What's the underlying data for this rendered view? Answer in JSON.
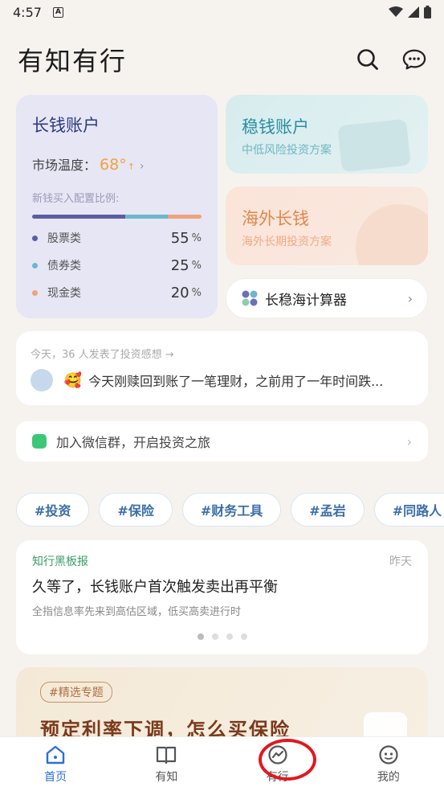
{
  "status_bar": {
    "time": "4:57",
    "notif": "A"
  },
  "header": {
    "title": "有知有行"
  },
  "long_account": {
    "name": "长钱账户",
    "temp_label": "市场温度：",
    "temp_value": "68°",
    "temp_arrow": "↑",
    "ratio_label": "新钱买入配置比例:",
    "colors": {
      "stocks": "#5a5ca6",
      "bonds": "#6cb8cb",
      "cash": "#eea37c"
    },
    "allocation": [
      {
        "label": "股票类",
        "pct": "55",
        "unit": "%",
        "fraction": 0.55
      },
      {
        "label": "债券类",
        "pct": "25",
        "unit": "%",
        "fraction": 0.25
      },
      {
        "label": "现金类",
        "pct": "20",
        "unit": "%",
        "fraction": 0.2
      }
    ]
  },
  "stable_account": {
    "name": "稳钱账户",
    "sub": "中低风险投资方案"
  },
  "overseas_account": {
    "name": "海外长钱",
    "sub": "海外长期投资方案"
  },
  "calculator": {
    "label": "长稳海计算器"
  },
  "feed": {
    "meta": "今天，36 人发表了投资感想 →",
    "emoji": "🥰",
    "text": "今天刚赎回到账了一笔理财，之前用了一年时间跌..."
  },
  "wechat": {
    "label": "加入微信群，开启投资之旅"
  },
  "tags": [
    "#投资",
    "#保险",
    "#财务工具",
    "#孟岩",
    "#同路人"
  ],
  "board": {
    "category": "知行黑板报",
    "date": "昨天",
    "headline": "久等了，长钱账户首次触发卖出再平衡",
    "desc": "全指信息率先来到高估区域，低买高卖进行时",
    "page_count": 4,
    "active_page": 1
  },
  "topic": {
    "pill": "#精选专题",
    "headline": "预定利率下调，怎么买保险"
  },
  "tabbar": {
    "tabs": [
      {
        "label": "首页",
        "icon": "home-icon",
        "active": true
      },
      {
        "label": "有知",
        "icon": "book-icon",
        "active": false
      },
      {
        "label": "有行",
        "icon": "trend-icon",
        "active": false
      },
      {
        "label": "我的",
        "icon": "profile-icon",
        "active": false
      }
    ]
  },
  "annotation": {
    "color": "#e1181e"
  }
}
